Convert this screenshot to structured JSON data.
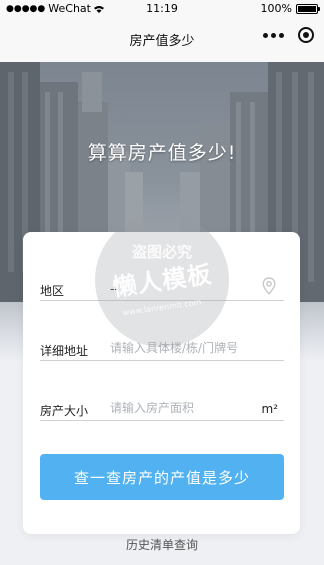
{
  "status_bar": {
    "signal": "●●●●●",
    "carrier": "WeChat",
    "time": "11:19",
    "battery": "100%"
  },
  "nav": {
    "title": "房产值多少"
  },
  "hero": {
    "title": "算算房产值多少!"
  },
  "form": {
    "area": {
      "label": "地区",
      "value": "--"
    },
    "address": {
      "label": "详细地址",
      "placeholder": "请输入具体楼/栋/门牌号"
    },
    "size": {
      "label": "房产大小",
      "placeholder": "请输入房产面积",
      "unit": "m²"
    }
  },
  "query_button": "查一查房产的产值是多少",
  "history_link": "历史清单查询",
  "watermark": {
    "top": "盗图必究",
    "main": "懒人模板",
    "sub": "www.lanrenmb.com"
  },
  "colors": {
    "accent": "#52b2f1",
    "card": "#ffffff",
    "page_bg": "#eef0f4"
  },
  "icons": [
    "wifi-icon",
    "battery-icon",
    "more-icon",
    "close-circle-icon",
    "location-pin-icon"
  ]
}
